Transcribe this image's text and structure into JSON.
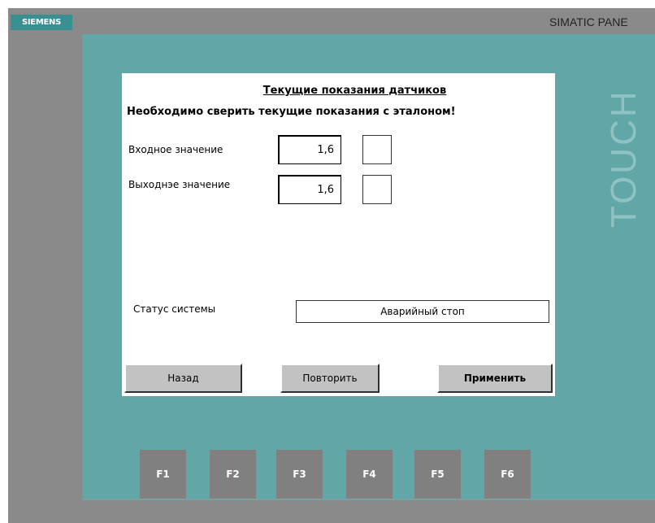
{
  "brand": {
    "logo": "SIEMENS",
    "model": "SIMATIC PANE",
    "touch": "TOUCH"
  },
  "screen": {
    "title": "Текущие показания датчиков",
    "subtitle": "Необходимо сверить текущие показания с эталоном!",
    "input_label": "Входное значение",
    "input_value": "1,6",
    "output_label": "Выходнэе значение",
    "output_value": "1,6",
    "status_label": "Статус системы",
    "status_value": "Аварийный стоп"
  },
  "buttons": {
    "back": "Назад",
    "retry": "Повторить",
    "apply": "Применить"
  },
  "function_keys": [
    "F1",
    "F2",
    "F3",
    "F4",
    "F5",
    "F6"
  ]
}
